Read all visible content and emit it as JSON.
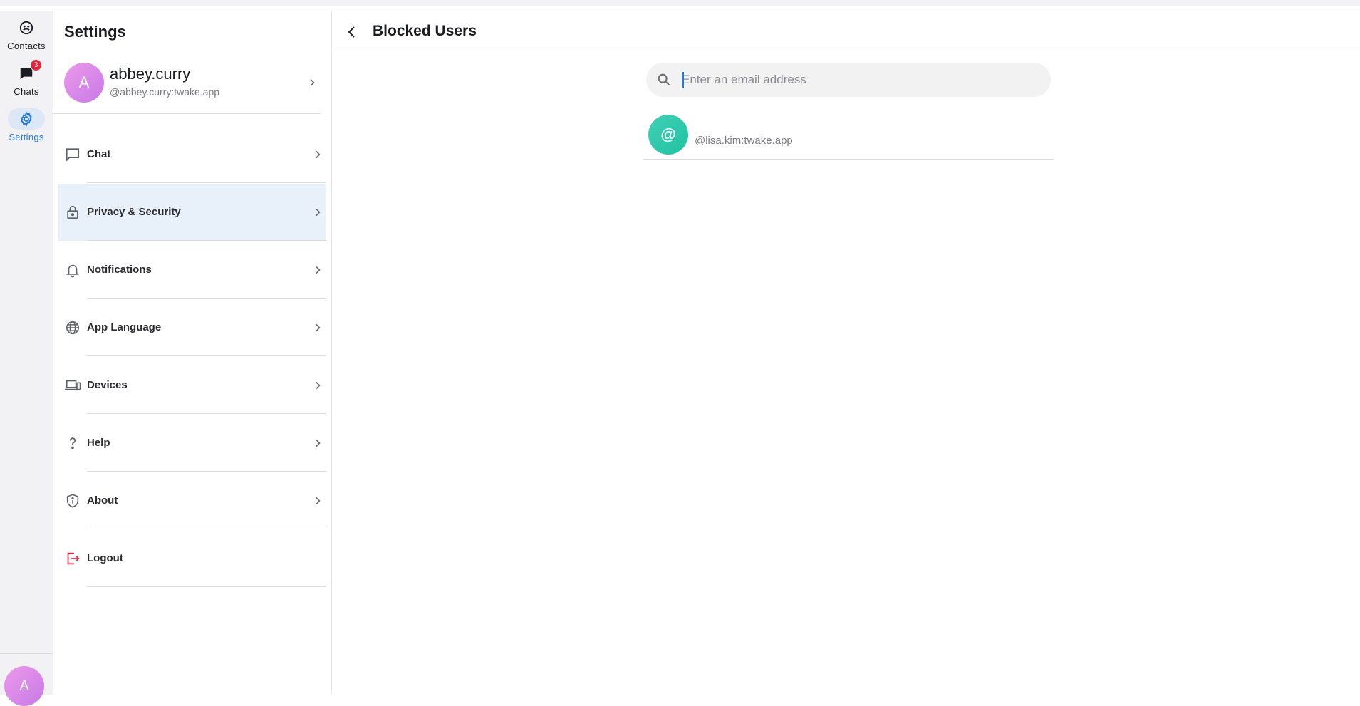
{
  "rail": {
    "items": [
      {
        "label": "Contacts",
        "icon": "contacts-icon"
      },
      {
        "label": "Chats",
        "icon": "chat-bubble-icon",
        "badge": "3"
      },
      {
        "label": "Settings",
        "icon": "gear-icon"
      }
    ],
    "avatar_initial": "A"
  },
  "settings": {
    "title": "Settings",
    "profile": {
      "initial": "A",
      "name": "abbey.curry",
      "id": "@abbey.curry:twake.app"
    },
    "items": [
      {
        "label": "Chat",
        "icon": "chat-icon"
      },
      {
        "label": "Privacy & Security",
        "icon": "lock-icon"
      },
      {
        "label": "Notifications",
        "icon": "bell-icon"
      },
      {
        "label": "App Language",
        "icon": "globe-icon"
      },
      {
        "label": "Devices",
        "icon": "devices-icon"
      },
      {
        "label": "Help",
        "icon": "question-icon"
      },
      {
        "label": "About",
        "icon": "shield-info-icon"
      },
      {
        "label": "Logout",
        "icon": "logout-icon"
      }
    ]
  },
  "main": {
    "title": "Blocked Users",
    "search": {
      "placeholder": "Enter an email address",
      "value": ""
    },
    "blocked_users": [
      {
        "initial": "@",
        "id": "@lisa.kim:twake.app"
      }
    ]
  },
  "colors": {
    "accent": "#1e7ae0",
    "badge": "#e8243a",
    "logout": "#e8243a",
    "active_bg": "#e8f0f9"
  }
}
